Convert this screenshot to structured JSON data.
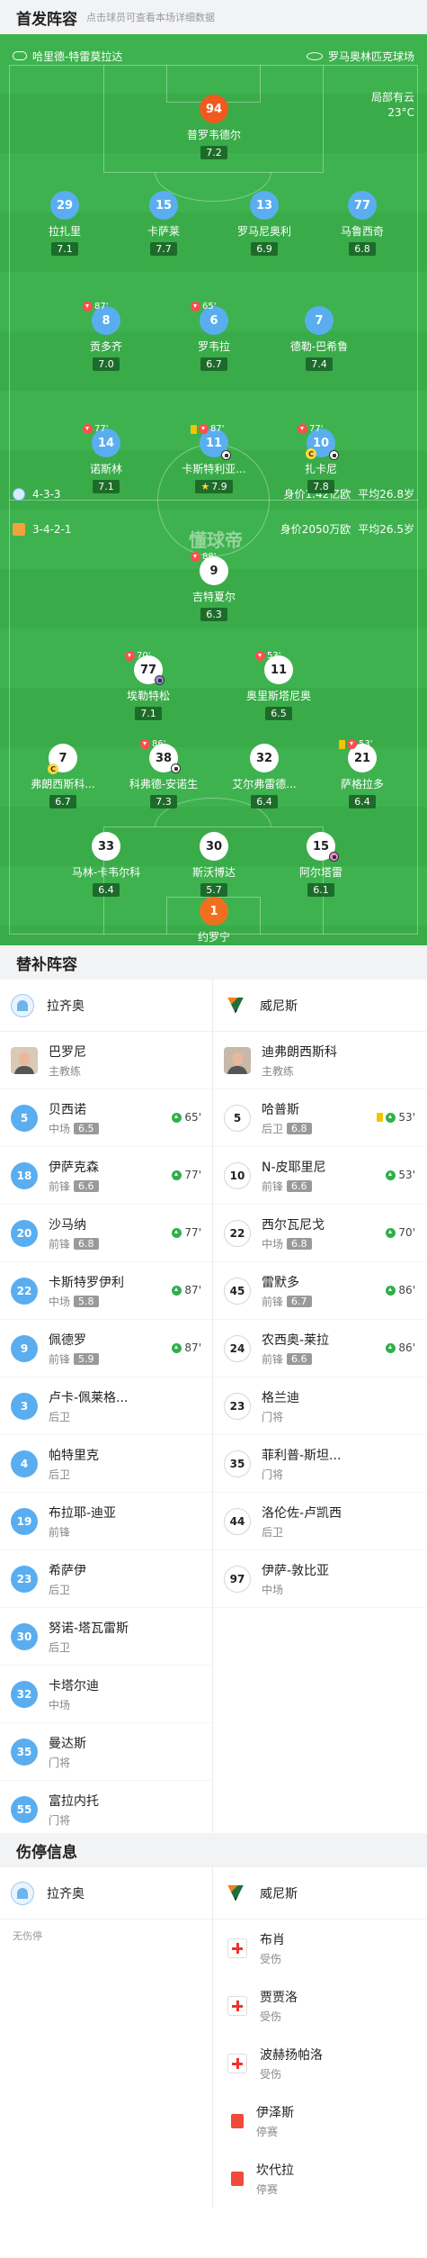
{
  "header": {
    "title": "首发阵容",
    "subtitle": "点击球员可查看本场详细数据"
  },
  "match": {
    "home_coach_label": "哈里德-特雷莫拉达",
    "stadium": "罗马奥林匹克球场",
    "weather": "局部有云",
    "temperature": "23°C",
    "watermark": "懂球帝"
  },
  "lazio": {
    "name": "拉齐奥",
    "formation": "4-3-3",
    "value": "身价1.42亿欧",
    "age": "平均26.8岁",
    "color": "#5aaef0",
    "players": [
      {
        "num": "94",
        "name": "普罗韦德尔",
        "rating": "7.2",
        "gk": true
      },
      {
        "num": "29",
        "name": "拉扎里",
        "rating": "7.1"
      },
      {
        "num": "15",
        "name": "卡萨莱",
        "rating": "7.7"
      },
      {
        "num": "13",
        "name": "罗马尼奥利",
        "rating": "6.9"
      },
      {
        "num": "77",
        "name": "马鲁西奇",
        "rating": "6.8"
      },
      {
        "num": "8",
        "name": "贡多齐",
        "rating": "7.0",
        "sub": "87'"
      },
      {
        "num": "6",
        "name": "罗韦拉",
        "rating": "6.7",
        "sub": "65'"
      },
      {
        "num": "7",
        "name": "德勒-巴希鲁",
        "rating": "7.4"
      },
      {
        "num": "14",
        "name": "诺斯林",
        "rating": "7.1",
        "sub": "77'"
      },
      {
        "num": "11",
        "name": "卡斯特利亚...",
        "rating": "7.9",
        "sub": "87'",
        "star": true,
        "yellow": true
      },
      {
        "num": "10",
        "name": "扎卡尼",
        "rating": "7.8",
        "sub": "77'",
        "captain": "C"
      }
    ]
  },
  "venezia": {
    "name": "威尼斯",
    "formation": "3-4-2-1",
    "value": "身价2050万欧",
    "age": "平均26.5岁",
    "players": [
      {
        "num": "9",
        "name": "吉特夏尔",
        "rating": "6.3",
        "sub": "88'"
      },
      {
        "num": "77",
        "name": "埃勒特松",
        "rating": "7.1",
        "sub": "70'"
      },
      {
        "num": "11",
        "name": "奥里斯塔尼奥",
        "rating": "6.5",
        "sub": "53'"
      },
      {
        "num": "7",
        "name": "弗朗西斯科...",
        "rating": "6.7",
        "captain": "C"
      },
      {
        "num": "38",
        "name": "科弗德-安诺生",
        "rating": "7.3",
        "sub": "86'"
      },
      {
        "num": "32",
        "name": "艾尔弗雷德...",
        "rating": "6.4"
      },
      {
        "num": "21",
        "name": "萨格拉多",
        "rating": "6.4",
        "sub": "53'",
        "yellow": true
      },
      {
        "num": "33",
        "name": "马林-卡韦尔科",
        "rating": "6.4"
      },
      {
        "num": "30",
        "name": "斯沃博达",
        "rating": "5.7"
      },
      {
        "num": "15",
        "name": "阿尔塔雷",
        "rating": "6.1"
      },
      {
        "num": "1",
        "name": "约罗宁",
        "rating": "6.7",
        "gk": true
      }
    ]
  },
  "subs": {
    "title": "替补阵容",
    "home": {
      "coach": {
        "name": "巴罗尼",
        "role": "主教练"
      },
      "players": [
        {
          "num": "5",
          "name": "贝西诺",
          "pos": "中场",
          "rating": "6.5",
          "in": "65'"
        },
        {
          "num": "18",
          "name": "伊萨克森",
          "pos": "前锋",
          "rating": "6.6",
          "in": "77'"
        },
        {
          "num": "20",
          "name": "沙马纳",
          "pos": "前锋",
          "rating": "6.8",
          "in": "77'"
        },
        {
          "num": "22",
          "name": "卡斯特罗伊利",
          "pos": "中场",
          "rating": "5.8",
          "in": "87'"
        },
        {
          "num": "9",
          "name": "佩德罗",
          "pos": "前锋",
          "rating": "5.9",
          "in": "87'"
        },
        {
          "num": "3",
          "name": "卢卡-佩莱格...",
          "pos": "后卫"
        },
        {
          "num": "4",
          "name": "帕特里克",
          "pos": "后卫"
        },
        {
          "num": "19",
          "name": "布拉耶-迪亚",
          "pos": "前锋"
        },
        {
          "num": "23",
          "name": "希萨伊",
          "pos": "后卫"
        },
        {
          "num": "30",
          "name": "努诺-塔瓦雷斯",
          "pos": "后卫"
        },
        {
          "num": "32",
          "name": "卡塔尔迪",
          "pos": "中场"
        },
        {
          "num": "35",
          "name": "曼达斯",
          "pos": "门将"
        },
        {
          "num": "55",
          "name": "富拉内托",
          "pos": "门将"
        }
      ]
    },
    "away": {
      "coach": {
        "name": "迪弗朗西斯科",
        "role": "主教练"
      },
      "players": [
        {
          "num": "5",
          "name": "哈普斯",
          "pos": "后卫",
          "rating": "6.8",
          "in": "53'",
          "yellow": true
        },
        {
          "num": "10",
          "name": "N-皮耶里尼",
          "pos": "前锋",
          "rating": "6.6",
          "in": "53'"
        },
        {
          "num": "22",
          "name": "西尔瓦尼戈",
          "pos": "中场",
          "rating": "6.8",
          "in": "70'"
        },
        {
          "num": "45",
          "name": "雷默多",
          "pos": "前锋",
          "rating": "6.7",
          "in": "86'"
        },
        {
          "num": "24",
          "name": "农西奥-莱拉",
          "pos": "前锋",
          "rating": "6.6",
          "in": "86'"
        },
        {
          "num": "23",
          "name": "格兰迪",
          "pos": "门将"
        },
        {
          "num": "35",
          "name": "菲利普-斯坦...",
          "pos": "门将"
        },
        {
          "num": "44",
          "name": "洛伦佐-卢凯西",
          "pos": "后卫"
        },
        {
          "num": "97",
          "name": "伊萨-敦比亚",
          "pos": "中场"
        }
      ]
    }
  },
  "injuries": {
    "title": "伤停信息",
    "home_none": "无伤停",
    "away": [
      {
        "name": "布肖",
        "status": "受伤",
        "type": "injury"
      },
      {
        "name": "贾贾洛",
        "status": "受伤",
        "type": "injury"
      },
      {
        "name": "波赫扬帕洛",
        "status": "受伤",
        "type": "injury"
      },
      {
        "name": "伊泽斯",
        "status": "停赛",
        "type": "red"
      },
      {
        "name": "坎代拉",
        "status": "停赛",
        "type": "red"
      }
    ]
  }
}
